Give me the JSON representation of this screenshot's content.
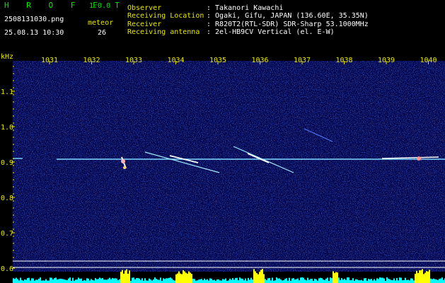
{
  "header": {
    "app_name": "H R O F F T",
    "version": "1.0.0",
    "filename": "2508131030.png",
    "datetime": "25.08.13 10:30",
    "meteor_label": "meteor",
    "meteor_count": "26",
    "info": [
      {
        "label": "Observer",
        "value": ": Takanori Kawachi"
      },
      {
        "label": "Receiving Location",
        "value": ": Ogaki, Gifu, JAPAN (136.60E, 35.35N)"
      },
      {
        "label": "Receiver",
        "value": ": R820T2(RTL-SDR) SDR-Sharp 53.1000MHz"
      },
      {
        "label": "Receiving antenna",
        "value": ": 2el-HB9CV Vertical (el. E-W)"
      }
    ]
  },
  "spectrogram": {
    "y_unit": "kHz",
    "x_ticks": [
      "1031",
      "1032",
      "1033",
      "1034",
      "1035",
      "1036",
      "1037",
      "1038",
      "1039",
      "1040"
    ],
    "y_ticks": [
      "1.1",
      "1.0",
      "0.9",
      "0.8",
      "0.7",
      "0.6"
    ],
    "colors": {
      "background": "#05054a",
      "noise": "#2a3ad8",
      "carrier": "#7fd8ff",
      "echo": "#ffffff",
      "level_fill": "#00ffff",
      "peak": "#ffff00",
      "axis_text": "#e8e800"
    }
  }
}
